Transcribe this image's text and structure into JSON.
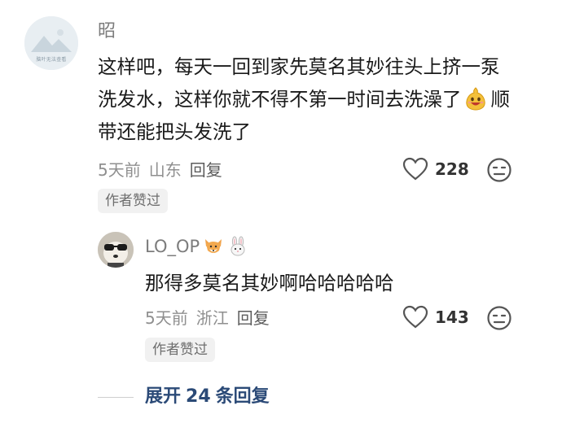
{
  "comment": {
    "username": "昭",
    "avatar_caption": "脑叶无法查看",
    "text_part1": "这样吧，每天一回到家先莫名其妙往头上挤一泵洗发水，这样你就不得不第一时间去洗澡了",
    "text_part2": "顺带还能把头发洗了",
    "emoji_icon": "grinning-pear-emoji",
    "time": "5天前",
    "location": "山东",
    "reply_label": "回复",
    "like_count": "228",
    "badge": "作者赞过"
  },
  "reply": {
    "username": "LO_OP",
    "username_icons": [
      "fox-face-icon",
      "rabbit-face-icon"
    ],
    "text": "那得多莫名其妙啊哈哈哈哈哈",
    "time": "5天前",
    "location": "浙江",
    "reply_label": "回复",
    "like_count": "143",
    "badge": "作者赞过"
  },
  "expand": {
    "prefix": "展开",
    "count": "24",
    "suffix": "条回复"
  },
  "colors": {
    "text": "#1a1a1a",
    "meta": "#8f8f8f",
    "link": "#2b4a77",
    "badge_bg": "#f1f1f1"
  }
}
